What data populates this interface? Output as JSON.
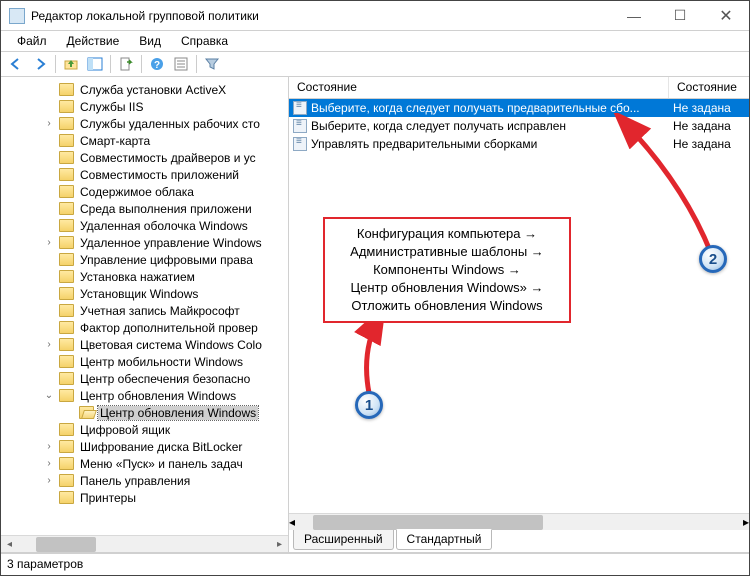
{
  "window": {
    "title": "Редактор локальной групповой политики"
  },
  "menu": {
    "file": "Файл",
    "action": "Действие",
    "view": "Вид",
    "help": "Справка"
  },
  "tree": [
    {
      "label": "Служба установки ActiveX",
      "level": 1
    },
    {
      "label": "Службы IIS",
      "level": 1
    },
    {
      "label": "Службы удаленных рабочих сто",
      "level": 1,
      "expandable": true
    },
    {
      "label": "Смарт-карта",
      "level": 1
    },
    {
      "label": "Совместимость драйверов и ус",
      "level": 1
    },
    {
      "label": "Совместимость приложений",
      "level": 1
    },
    {
      "label": "Содержимое облака",
      "level": 1
    },
    {
      "label": "Среда выполнения приложени",
      "level": 1
    },
    {
      "label": "Удаленная оболочка Windows",
      "level": 1
    },
    {
      "label": "Удаленное управление Windows",
      "level": 1,
      "expandable": true
    },
    {
      "label": "Управление цифровыми права",
      "level": 1
    },
    {
      "label": "Установка нажатием",
      "level": 1
    },
    {
      "label": "Установщик Windows",
      "level": 1
    },
    {
      "label": "Учетная запись Майкрософт",
      "level": 1
    },
    {
      "label": "Фактор дополнительной провер",
      "level": 1
    },
    {
      "label": "Цветовая система Windows Colo",
      "level": 1,
      "expandable": true
    },
    {
      "label": "Центр мобильности Windows",
      "level": 1
    },
    {
      "label": "Центр обеспечения безопасно",
      "level": 1
    },
    {
      "label": "Центр обновления Windows",
      "level": 1,
      "expandable": true,
      "expanded": true
    },
    {
      "label": "Центр обновления Windows",
      "level": 2,
      "selected": true,
      "open": true
    },
    {
      "label": "Цифровой ящик",
      "level": 1
    },
    {
      "label": "Шифрование диска BitLocker",
      "level": 1,
      "expandable": true
    },
    {
      "label": "Меню «Пуск» и панель задач",
      "level": 1,
      "expandable": true
    },
    {
      "label": "Панель управления",
      "level": 1,
      "expandable": true
    },
    {
      "label": "Принтеры",
      "level": 1
    }
  ],
  "list": {
    "col_name": "Состояние",
    "col_state": "Состояние",
    "rows": [
      {
        "name": "Выберите, когда следует получать предварительные сбо...",
        "state": "Не задана",
        "selected": true
      },
      {
        "name": "Выберите, когда следует получать исправлен",
        "state": "Не задана"
      },
      {
        "name": "Управлять предварительными сборками",
        "state": "Не задана"
      }
    ]
  },
  "tabs": {
    "extended": "Расширенный",
    "standard": "Стандартный"
  },
  "status": {
    "text": "3 параметров"
  },
  "annotation": {
    "lines": [
      "Конфигурация компьютера →",
      "Административные шаблоны →",
      "Компоненты Windows →",
      "Центр обновления Windows» →",
      "Отложить обновления Windows"
    ],
    "badge1": "1",
    "badge2": "2"
  }
}
